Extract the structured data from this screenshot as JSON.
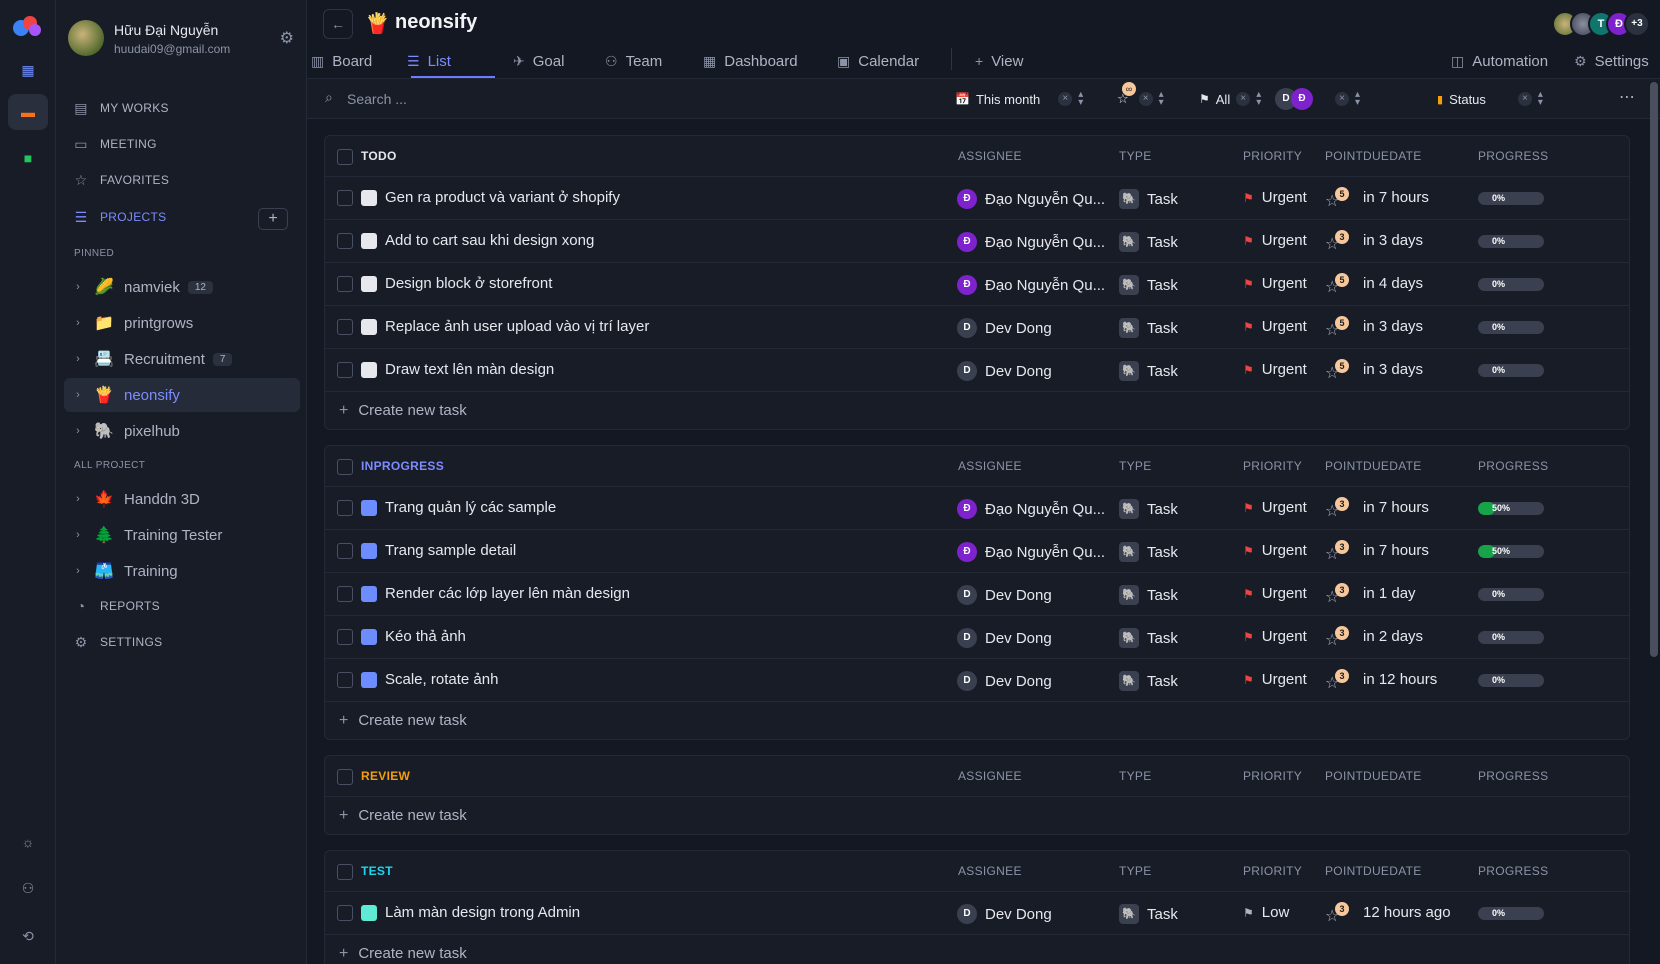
{
  "rail": {
    "icons": [
      "grid-icon",
      "project-icon",
      "video-icon",
      "sun-icon",
      "add-user-icon",
      "logout-icon"
    ]
  },
  "user": {
    "name": "Hữu Đại Nguyễn",
    "email": "huudai09@gmail.com"
  },
  "nav": {
    "my_works": "MY WORKS",
    "meeting": "MEETING",
    "favorites": "FAVORITES",
    "projects": "PROJECTS",
    "reports": "REPORTS",
    "settings": "SETTINGS",
    "pinned_label": "PINNED",
    "all_project_label": "ALL PROJECT"
  },
  "pinned": [
    {
      "name": "namviek",
      "emoji": "🌽",
      "count": "12"
    },
    {
      "name": "printgrows",
      "emoji": "📁",
      "count": ""
    },
    {
      "name": "Recruitment",
      "emoji": "📇",
      "count": "7"
    },
    {
      "name": "neonsify",
      "emoji": "🍟",
      "count": ""
    },
    {
      "name": "pixelhub",
      "emoji": "🐘",
      "count": ""
    }
  ],
  "all_projects": [
    {
      "name": "Handdn 3D",
      "emoji": "🍁"
    },
    {
      "name": "Training Tester",
      "emoji": "🌲"
    },
    {
      "name": "Training",
      "emoji": "🩳"
    }
  ],
  "header": {
    "project_icon": "🍟",
    "project_title": "neonsify",
    "members": [
      "",
      "",
      "T",
      "Đ",
      "+3"
    ]
  },
  "tabs": {
    "board": "Board",
    "list": "List",
    "goal": "Goal",
    "team": "Team",
    "dashboard": "Dashboard",
    "calendar": "Calendar",
    "view": "View",
    "automation": "Automation",
    "settings": "Settings"
  },
  "filters": {
    "search_placeholder": "Search ...",
    "date": "This month",
    "date_icon": "📅",
    "point_badge": "∞",
    "priority": "All",
    "assignee_initials": [
      "D",
      "Đ"
    ],
    "status": "Status",
    "more": "⋯"
  },
  "columns": {
    "assignee": "ASSIGNEE",
    "type": "TYPE",
    "priority": "PRIORITY",
    "point": "POINT",
    "duedate": "DUEDATE",
    "progress": "PROGRESS"
  },
  "create_label": "Create new task",
  "groups": [
    {
      "title": "TODO",
      "color": "#e6e8ee",
      "status_color": "#e6e8ee",
      "tasks": [
        {
          "name": "Gen ra product và variant ở shopify",
          "assignee": "Đạo Nguyễn Qu...",
          "initial": "Đ",
          "avatar": "purple",
          "type": "Task",
          "priority": "Urgent",
          "point": "5",
          "due": "in 7 hours",
          "progress": 0,
          "progress_label": "0%"
        },
        {
          "name": "Add to cart sau khi design xong",
          "assignee": "Đạo Nguyễn Qu...",
          "initial": "Đ",
          "avatar": "purple",
          "type": "Task",
          "priority": "Urgent",
          "point": "3",
          "due": "in 3 days",
          "progress": 0,
          "progress_label": "0%"
        },
        {
          "name": "Design block ở storefront",
          "assignee": "Đạo Nguyễn Qu...",
          "initial": "Đ",
          "avatar": "purple",
          "type": "Task",
          "priority": "Urgent",
          "point": "5",
          "due": "in 4 days",
          "progress": 0,
          "progress_label": "0%"
        },
        {
          "name": "Replace ảnh user upload vào vị trí layer",
          "assignee": "Dev Dong",
          "initial": "D",
          "avatar": "grey",
          "type": "Task",
          "priority": "Urgent",
          "point": "5",
          "due": "in 3 days",
          "progress": 0,
          "progress_label": "0%"
        },
        {
          "name": "Draw text lên màn design",
          "assignee": "Dev Dong",
          "initial": "D",
          "avatar": "grey",
          "type": "Task",
          "priority": "Urgent",
          "point": "5",
          "due": "in 3 days",
          "progress": 0,
          "progress_label": "0%"
        }
      ]
    },
    {
      "title": "INPROGRESS",
      "color": "#7c8cff",
      "status_color": "#6d8dff",
      "tasks": [
        {
          "name": "Trang quản lý các sample",
          "assignee": "Đạo Nguyễn Qu...",
          "initial": "Đ",
          "avatar": "purple",
          "type": "Task",
          "priority": "Urgent",
          "point": "3",
          "due": "in 7 hours",
          "progress": 50,
          "progress_label": "50%"
        },
        {
          "name": "Trang sample detail",
          "assignee": "Đạo Nguyễn Qu...",
          "initial": "Đ",
          "avatar": "purple",
          "type": "Task",
          "priority": "Urgent",
          "point": "3",
          "due": "in 7 hours",
          "progress": 50,
          "progress_label": "50%"
        },
        {
          "name": "Render các lớp layer lên màn design",
          "assignee": "Dev Dong",
          "initial": "D",
          "avatar": "grey",
          "type": "Task",
          "priority": "Urgent",
          "point": "3",
          "due": "in 1 day",
          "progress": 0,
          "progress_label": "0%"
        },
        {
          "name": "Kéo thả ảnh",
          "assignee": "Dev Dong",
          "initial": "D",
          "avatar": "grey",
          "type": "Task",
          "priority": "Urgent",
          "point": "3",
          "due": "in 2 days",
          "progress": 0,
          "progress_label": "0%"
        },
        {
          "name": "Scale, rotate ảnh",
          "assignee": "Dev Dong",
          "initial": "D",
          "avatar": "grey",
          "type": "Task",
          "priority": "Urgent",
          "point": "3",
          "due": "in 12 hours",
          "progress": 0,
          "progress_label": "0%"
        }
      ]
    },
    {
      "title": "REVIEW",
      "color": "#f59e0b",
      "status_color": "#f59e0b",
      "tasks": []
    },
    {
      "title": "TEST",
      "color": "#22d3ee",
      "status_color": "#5eead4",
      "tasks": [
        {
          "name": "Làm màn design trong Admin",
          "assignee": "Dev Dong",
          "initial": "D",
          "avatar": "grey",
          "type": "Task",
          "priority": "Low",
          "point": "3",
          "due": "12 hours ago",
          "progress": 0,
          "progress_label": "0%"
        }
      ]
    }
  ],
  "colors": {
    "accent": "#7c8cff",
    "urgent": "#ef4444",
    "low": "#aeb4c3",
    "progress_fill": "#16a34a"
  }
}
